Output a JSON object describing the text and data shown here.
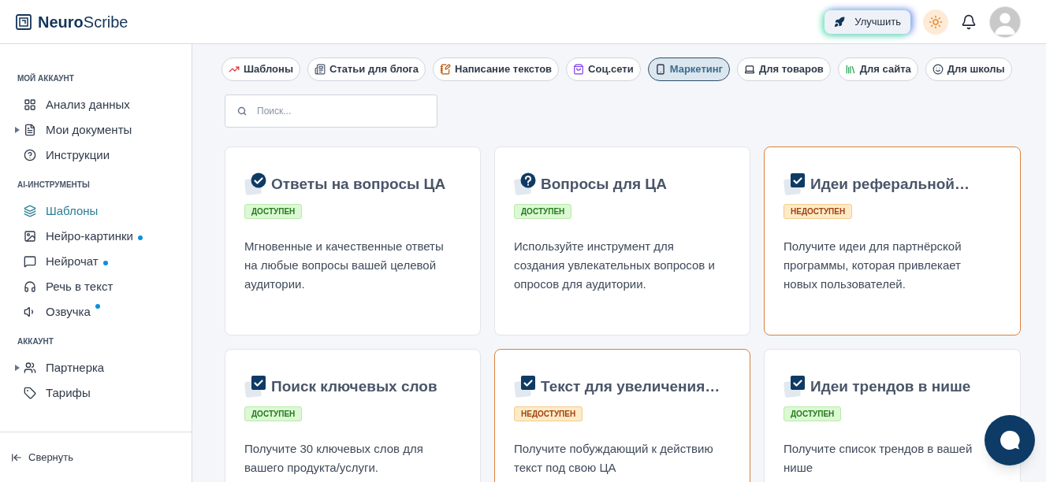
{
  "logo": {
    "bold": "Neuro",
    "regular": "Scribe"
  },
  "header": {
    "upgrade_button": "Улучшить"
  },
  "sidebar": {
    "sections": [
      {
        "title": "МОЙ АККАУНТ",
        "items": [
          {
            "label": "Анализ данных",
            "selected": false,
            "dot": false
          },
          {
            "label": "Мои документы",
            "selected": false,
            "dot": false,
            "expanded": false
          },
          {
            "label": "Инструкции",
            "selected": false,
            "dot": false
          }
        ]
      },
      {
        "title": "AI-ИНСТРУМЕНТЫ",
        "items": [
          {
            "label": "Шаблоны",
            "selected": true,
            "dot": false
          },
          {
            "label": "Нейро-картинки",
            "selected": false,
            "dot": true
          },
          {
            "label": "Нейрочат",
            "selected": false,
            "dot": true
          },
          {
            "label": "Речь в текст",
            "selected": false,
            "dot": false
          },
          {
            "label": "Озвучка",
            "selected": false,
            "dot": true
          }
        ]
      },
      {
        "title": "АККАУНТ",
        "items": [
          {
            "label": "Партнерка",
            "selected": false,
            "dot": false,
            "expanded": false
          },
          {
            "label": "Тарифы",
            "selected": false,
            "dot": false
          }
        ]
      }
    ],
    "collapse": "Свернуть"
  },
  "categories": [
    {
      "label": "Шаблоны",
      "selected": false
    },
    {
      "label": "Статьи для блога",
      "selected": false
    },
    {
      "label": "Написание текстов",
      "selected": false
    },
    {
      "label": "Соц.сети",
      "selected": false
    },
    {
      "label": "Маркетинг",
      "selected": true
    },
    {
      "label": "Для товаров",
      "selected": false
    },
    {
      "label": "Для сайта",
      "selected": false
    },
    {
      "label": "Для школы",
      "selected": false
    }
  ],
  "search": {
    "placeholder": "Поиск..."
  },
  "cards": [
    {
      "title": "Ответы на вопросы ЦА",
      "available": true,
      "status": "ДОСТУПЕН",
      "description": "Мгновенные и качественные ответы на любые вопросы вашей целевой аудитории."
    },
    {
      "title": "Вопросы для ЦА",
      "available": true,
      "status": "ДОСТУПЕН",
      "description": "Используйте инструмент для создания увлекательных вопросов и опросов для аудитории."
    },
    {
      "title": "Идеи реферальной…",
      "available": false,
      "status": "НЕДОСТУПЕН",
      "description": "Получите идеи для партнёрской программы, которая привлекает новых пользователей."
    },
    {
      "title": "Поиск ключевых слов",
      "available": true,
      "status": "ДОСТУПЕН",
      "description": "Получите 30 ключевых слов для вашего продукта/услуги."
    },
    {
      "title": "Текст для увеличения…",
      "available": false,
      "status": "НЕДОСТУПЕН",
      "description": "Получите побуждающий к действию текст под свою ЦА"
    },
    {
      "title": "Идеи трендов в нише",
      "available": true,
      "status": "ДОСТУПЕН",
      "description": "Получите список трендов в вашей нише"
    }
  ]
}
